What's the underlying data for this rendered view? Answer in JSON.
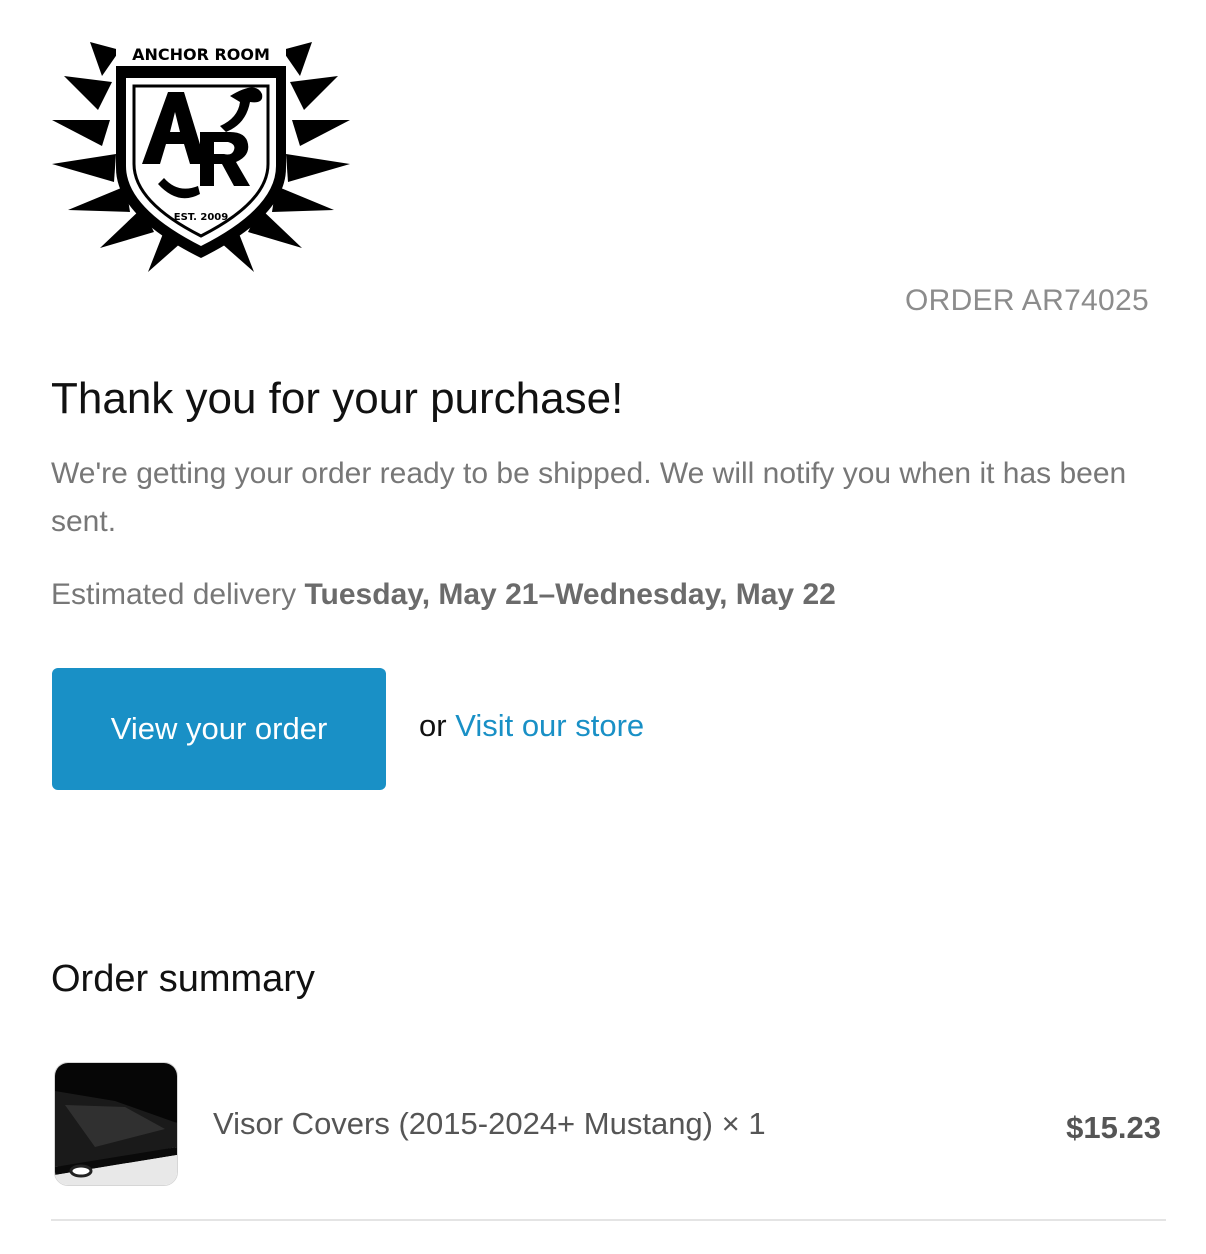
{
  "brand": {
    "logo_text": "ANCHOR ROOM",
    "logo_monogram": "AR",
    "logo_est": "EST. 2009"
  },
  "order": {
    "number_label": "ORDER AR74025"
  },
  "confirmation": {
    "title": "Thank you for your purchase!",
    "message": "We're getting your order ready to be shipped. We will notify you when it has been sent.",
    "delivery_prefix": "Estimated delivery",
    "delivery_range": "Tuesday, May 21–Wednesday, May 22"
  },
  "actions": {
    "view_order_label": "View your order",
    "or_text": "or",
    "visit_store_label": "Visit our store"
  },
  "summary": {
    "title": "Order summary",
    "items": [
      {
        "name": "Visor Covers (2015-2024+ Mustang) × 1",
        "price": "$15.23"
      }
    ]
  },
  "colors": {
    "accent": "#1990c6",
    "muted_text": "#777777"
  }
}
